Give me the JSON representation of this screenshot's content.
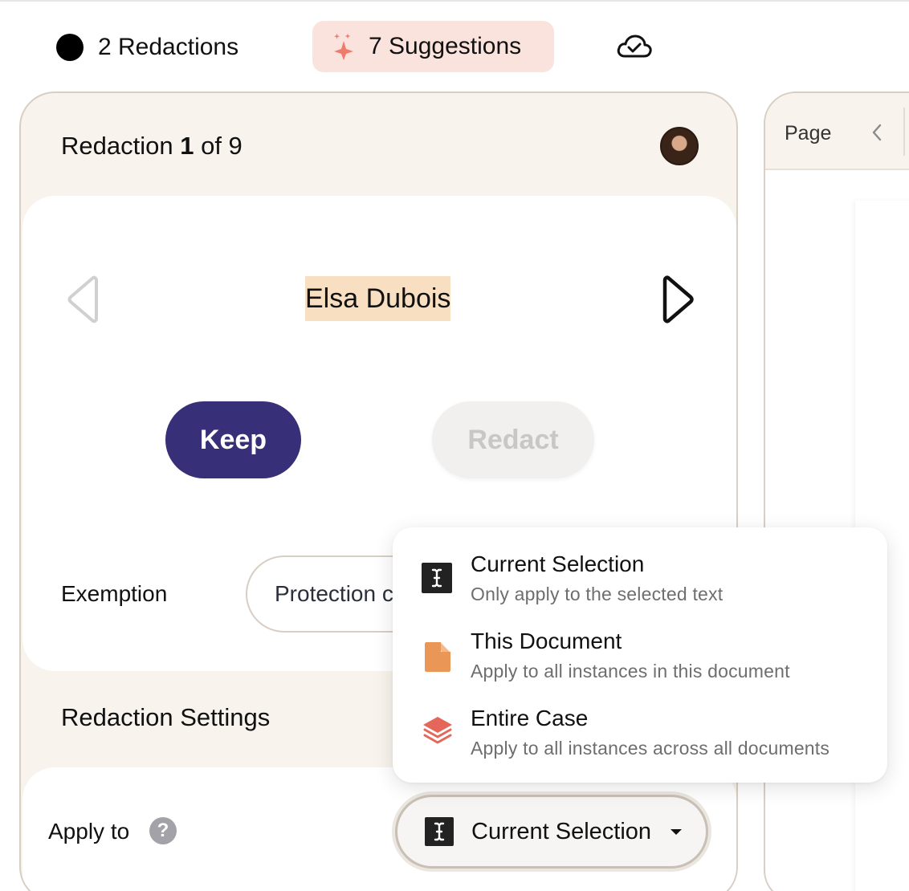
{
  "topbar": {
    "redactions_label": "2 Redactions",
    "suggestions_label": "7 Suggestions"
  },
  "redaction": {
    "title_prefix": "Redaction ",
    "current": "1",
    "title_suffix": " of 9",
    "entity": "Elsa Dubois",
    "keep_label": "Keep",
    "redact_label": "Redact",
    "exemption_label": "Exemption",
    "exemption_value": "Protection c"
  },
  "settings": {
    "title": "Redaction Settings",
    "apply_label": "Apply to",
    "help_symbol": "?",
    "apply_value": "Current Selection"
  },
  "preview": {
    "page_label": "Page"
  },
  "dropdown": {
    "items": [
      {
        "title": "Current Selection",
        "description": "Only apply to the selected text",
        "icon": "text-cursor-icon"
      },
      {
        "title": "This Document",
        "description": "Apply to all instances in this document",
        "icon": "document-icon"
      },
      {
        "title": "Entire Case",
        "description": "Apply to all instances across all documents",
        "icon": "layers-icon"
      }
    ]
  },
  "colors": {
    "accent": "#373079",
    "panel_bg": "#f8f3ec",
    "highlight": "#f9dfc2",
    "suggestions_bg": "#fbe3dd",
    "sparkle": "#ef7b6b",
    "document": "#ea9656",
    "layers": "#e4675a"
  }
}
